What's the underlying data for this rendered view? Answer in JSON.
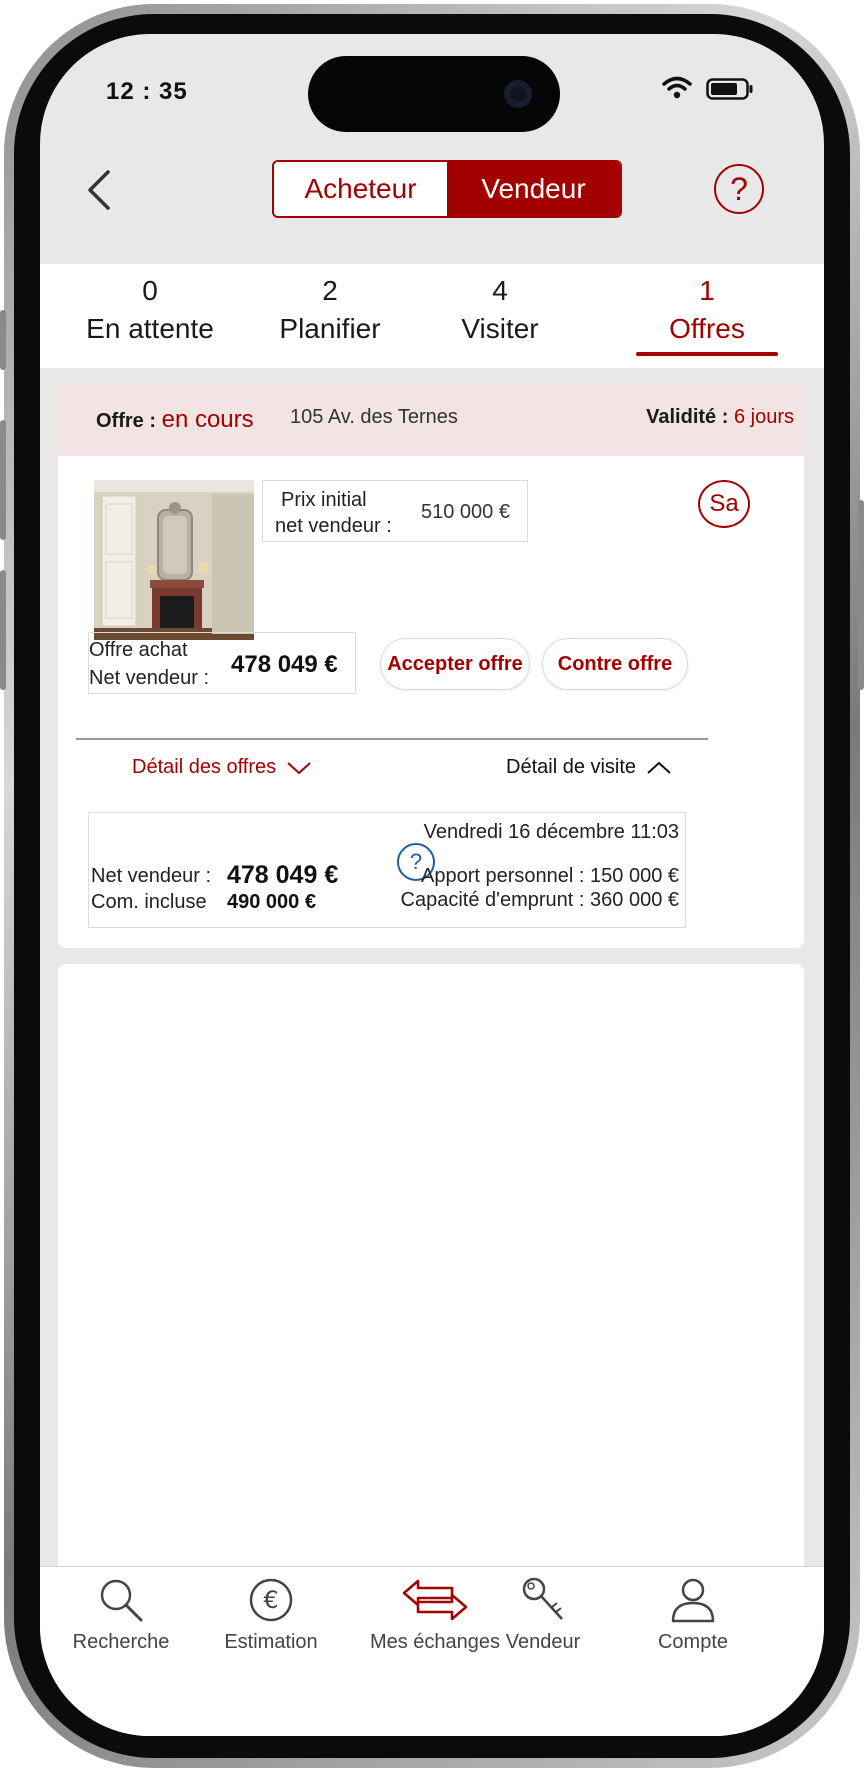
{
  "status_bar": {
    "time": "12 : 35"
  },
  "header": {
    "segment": {
      "buyer_label": "Acheteur",
      "seller_label": "Vendeur",
      "selected": "Vendeur"
    },
    "help_glyph": "?"
  },
  "tabs": [
    {
      "count": "0",
      "label": "En attente"
    },
    {
      "count": "2",
      "label": "Planifier"
    },
    {
      "count": "4",
      "label": "Visiter"
    },
    {
      "count": "1",
      "label": "Offres",
      "active": true
    }
  ],
  "offer": {
    "status_label": "Offre",
    "status_sep": ":",
    "status_value": "en cours",
    "address": "105 Av. des Ternes",
    "validity_label": "Validité",
    "validity_sep": ":",
    "validity_value": "6 jours",
    "initial_price_label_1": "Prix initial",
    "initial_price_label_2": "net vendeur :",
    "initial_price_value": "510 000 €",
    "avatar_initials": "Sa",
    "purchase_offer_label_1": "Offre  achat",
    "purchase_offer_label_2": "Net vendeur :",
    "purchase_offer_value": "478 049 €",
    "accept_label": "Accepter offre",
    "counter_label": "Contre offre",
    "detail_offers_label": "Détail des offres",
    "detail_visit_label": "Détail de visite",
    "detail": {
      "date": "Vendredi 16 décembre 11:03",
      "net_label": "Net vendeur :",
      "net_value": "478 049 €",
      "com_label": "Com. incluse",
      "com_value": "490 000 €",
      "help_glyph": "?",
      "apport": "Apport personnel : 150 000 €",
      "capacite": "Capacité d'emprunt : 360 000 €"
    }
  },
  "bottom_nav": [
    {
      "label": "Recherche",
      "icon": "search-icon"
    },
    {
      "label": "Estimation",
      "icon": "euro-icon"
    },
    {
      "label": "Mes échanges",
      "icon": "exchange-icon",
      "active": true
    },
    {
      "label": "Vendeur",
      "icon": "key-icon"
    },
    {
      "label": "Compte",
      "icon": "user-icon"
    }
  ],
  "colors": {
    "accent": "#a30000",
    "header_bg": "#f3e4e4",
    "screen_bg": "#e8e8e8",
    "help_blue": "#1f5fa0"
  }
}
